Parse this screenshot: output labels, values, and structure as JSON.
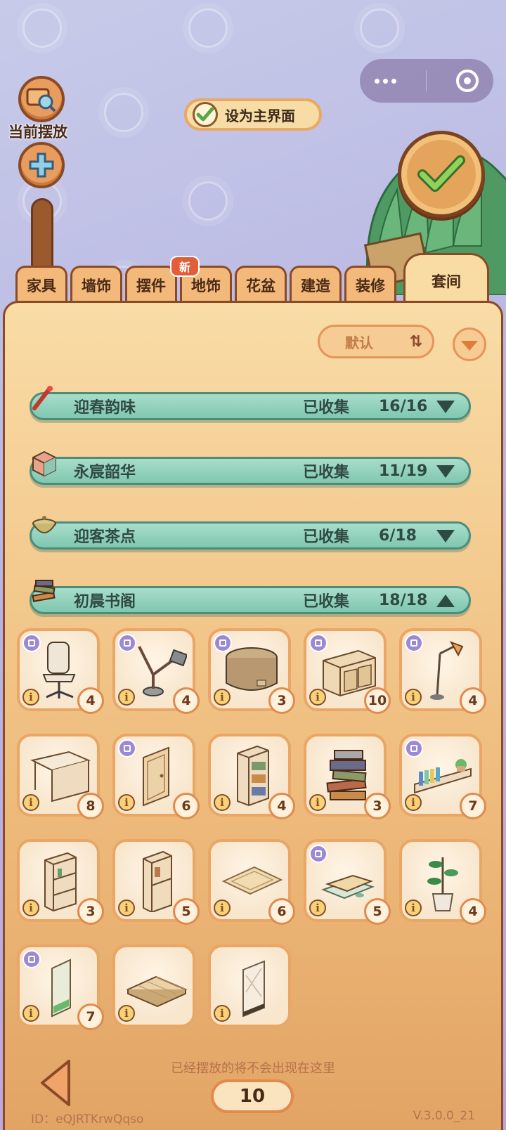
{
  "header": {
    "current_placement_label": "当前摆放",
    "set_as_main_label": "设为主界面"
  },
  "tabs": [
    {
      "label": "家具"
    },
    {
      "label": "墙饰"
    },
    {
      "label": "摆件",
      "badge": "新"
    },
    {
      "label": "地饰"
    },
    {
      "label": "花盆"
    },
    {
      "label": "建造"
    },
    {
      "label": "装修"
    },
    {
      "label": "套间",
      "active": true
    }
  ],
  "sort": {
    "label": "默认"
  },
  "sets": [
    {
      "name": "迎春韵味",
      "collected_label": "已收集",
      "count": "16/16",
      "expanded": false
    },
    {
      "name": "永宸韶华",
      "collected_label": "已收集",
      "count": "11/19",
      "expanded": false
    },
    {
      "name": "迎客茶点",
      "collected_label": "已收集",
      "count": "6/18",
      "expanded": false
    },
    {
      "name": "初晨书阁",
      "collected_label": "已收集",
      "count": "18/18",
      "expanded": true
    }
  ],
  "items": [
    {
      "icon": "office-chair",
      "count": "4"
    },
    {
      "icon": "desk-lamp",
      "count": "4"
    },
    {
      "icon": "round-ottoman",
      "count": "3"
    },
    {
      "icon": "sideboard-cabinet",
      "count": "10"
    },
    {
      "icon": "floor-lamp",
      "count": "4"
    },
    {
      "icon": "writing-desk",
      "count": "8"
    },
    {
      "icon": "wooden-door",
      "count": "6"
    },
    {
      "icon": "bookcase",
      "count": "4"
    },
    {
      "icon": "book-stack",
      "count": "3"
    },
    {
      "icon": "wall-bookshelf",
      "count": "7"
    },
    {
      "icon": "cube-shelf",
      "count": "3"
    },
    {
      "icon": "tall-cabinet",
      "count": "5"
    },
    {
      "icon": "floor-rug",
      "count": "6"
    },
    {
      "icon": "desk-pad",
      "count": "5"
    },
    {
      "icon": "potted-plant",
      "count": "4"
    },
    {
      "icon": "window-panel",
      "count": "7"
    },
    {
      "icon": "wood-floor-tile",
      "count": ""
    },
    {
      "icon": "glass-wall-panel",
      "count": ""
    }
  ],
  "footer": {
    "hint": "已经摆放的将不会出现在这里",
    "page": "10",
    "user_id": "ID：eQJRTKrwQqso",
    "version": "V.3.0.0_21"
  },
  "colors": {
    "panel_bg": "#f9dca6",
    "set_row_bg": "#7fc7b0",
    "tab_border": "#8b4a26",
    "accent_orange": "#e08a4c"
  }
}
